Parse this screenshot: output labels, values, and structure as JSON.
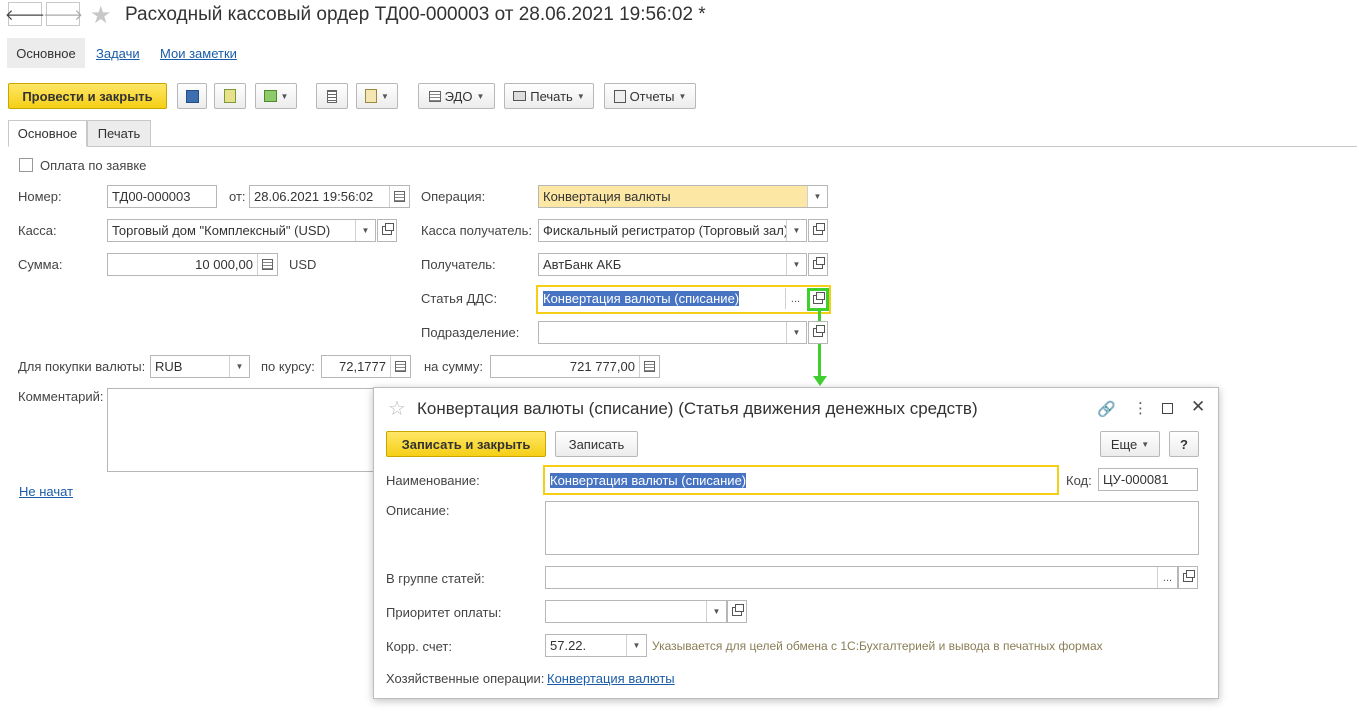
{
  "window": {
    "title": "Расходный кассовый ордер ТД00-000003 от 28.06.2021 19:56:02 *"
  },
  "nav": {
    "back_icon": "arrow-left-icon",
    "forward_icon": "arrow-right-icon",
    "favorite_icon": "star-icon"
  },
  "section_tabs": [
    "Основное",
    "Задачи",
    "Мои заметки"
  ],
  "toolbar": {
    "post_close_label": "Провести и закрыть",
    "edo_label": "ЭДО",
    "print_label": "Печать",
    "reports_label": "Отчеты"
  },
  "form_tabs": [
    "Основное",
    "Печать"
  ],
  "form": {
    "by_request_label": "Оплата по заявке",
    "number_label": "Номер:",
    "number_value": "ТД00-000003",
    "from_label": "от:",
    "date_value": "28.06.2021 19:56:02",
    "operation_label": "Операция:",
    "operation_value": "Конвертация валюты",
    "cash_label": "Касса:",
    "cash_value": "Торговый дом \"Комплексный\" (USD)",
    "cash_receiver_label": "Касса получатель:",
    "cash_receiver_value": "Фискальный регистратор (Торговый зал)",
    "sum_label": "Сумма:",
    "sum_value": "10 000,00",
    "currency": "USD",
    "recipient_label": "Получатель:",
    "recipient_value": "АвтБанк АКБ",
    "dds_label": "Статья ДДС:",
    "dds_value": "Конвертация валюты (списание)",
    "dept_label": "Подразделение:",
    "dept_value": "",
    "buy_currency_label": "Для покупки валюты:",
    "buy_currency_value": "RUB",
    "rate_label": "по курсу:",
    "rate_value": "72,1777",
    "amount_label": "на сумму:",
    "amount_value": "721 777,00",
    "comment_label": "Комментарий:",
    "status_link": "Не начат"
  },
  "modal": {
    "title": "Конвертация валюты (списание) (Статья движения денежных средств)",
    "save_close_label": "Записать и закрыть",
    "save_label": "Записать",
    "more_label": "Еще",
    "help_label": "?",
    "name_label": "Наименование:",
    "name_value": "Конвертация валюты (списание)",
    "code_label": "Код:",
    "code_value": "ЦУ-000081",
    "description_label": "Описание:",
    "group_label": "В группе статей:",
    "priority_label": "Приоритет оплаты:",
    "account_label": "Корр. счет:",
    "account_value": "57.22.",
    "account_hint": "Указывается для целей обмена с 1С:Бухгалтерией и вывода в печатных формах",
    "operations_label": "Хозяйственные операции:",
    "operations_link": "Конвертация валюты"
  },
  "colors": {
    "accent_yellow": "#f5cf16",
    "selection_blue": "#4673c2",
    "highlight_green": "#3fcf2f",
    "link_blue": "#1a5ca8"
  }
}
